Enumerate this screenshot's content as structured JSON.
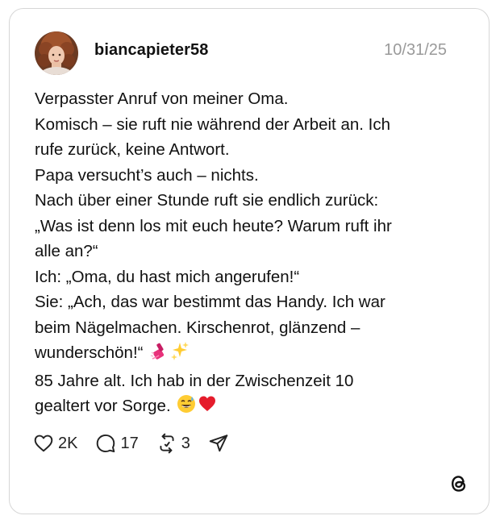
{
  "post": {
    "username": "biancapieter58",
    "date": "10/31/25",
    "lines": [
      "Verpasster Anruf von meiner Oma.",
      "Komisch – sie ruft nie während der Arbeit an. Ich",
      "rufe zurück, keine Antwort.",
      "Papa versucht’s auch – nichts.",
      "Nach über einer Stunde ruft sie endlich zurück:",
      "„Was ist denn los mit euch heute? Warum ruft ihr",
      "alle an?“",
      "Ich: „Oma, du hast mich angerufen!“",
      "Sie: „Ach, das war bestimmt das Handy. Ich war",
      "beim Nägelmachen. Kirschenrot, glänzend –",
      "wunderschön!“",
      "85 Jahre alt. Ich hab in der Zwischenzeit 10",
      "gealtert vor Sorge."
    ],
    "emojis": {
      "line_11": [
        "nail-polish-emoji",
        "sparkles-emoji"
      ],
      "line_13": [
        "sweat-smile-emoji",
        "red-heart-emoji"
      ]
    }
  },
  "actions": {
    "likes": "2K",
    "replies": "17",
    "reposts": "3"
  },
  "icons": {
    "like": "heart-icon",
    "reply": "comment-icon",
    "repost": "repost-icon",
    "share": "send-icon",
    "brand": "threads-logo-icon"
  },
  "colors": {
    "text": "#111111",
    "muted": "#9a9a9a",
    "border": "#d6d6d6",
    "heart": "#e0245e"
  }
}
